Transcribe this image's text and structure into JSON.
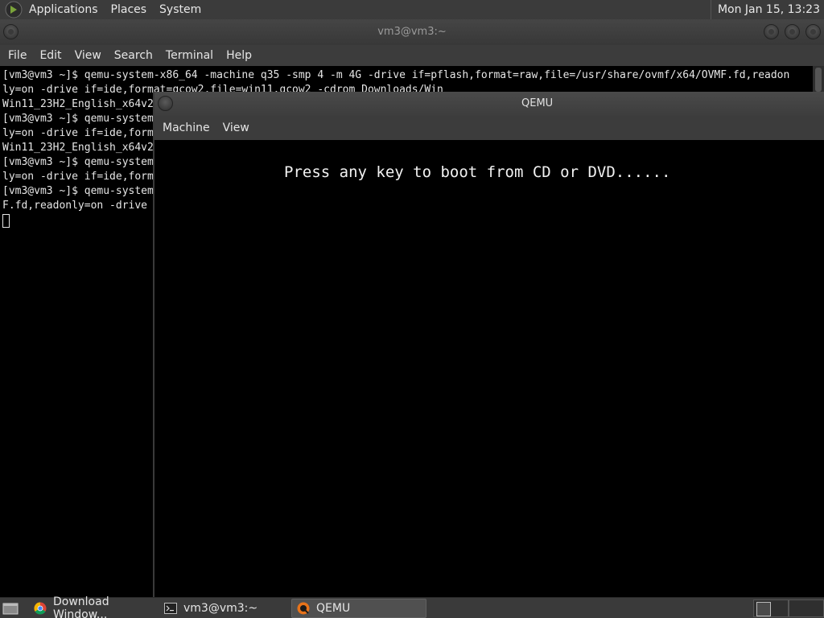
{
  "top_panel": {
    "menus": [
      "Applications",
      "Places",
      "System"
    ],
    "clock": "Mon Jan 15, 13:23"
  },
  "terminal": {
    "title": "vm3@vm3:~",
    "menus": [
      "File",
      "Edit",
      "View",
      "Search",
      "Terminal",
      "Help"
    ],
    "lines": [
      "[vm3@vm3 ~]$ qemu-system-x86_64 -machine q35 -smp 4 -m 4G -drive if=pflash,format=raw,file=/usr/share/ovmf/x64/OVMF.fd,readon",
      "ly=on -drive if=ide,format=qcow2,file=win11.qcow2 -cdrom Downloads/Win",
      "Win11_23H2_English_x64v2",
      "[vm3@vm3 ~]$ qemu-system",
      "ly=on -drive if=ide,form",
      "Win11_23H2_English_x64v2",
      "[vm3@vm3 ~]$ qemu-system",
      "ly=on -drive if=ide,form",
      "[vm3@vm3 ~]$ qemu-system",
      "F.fd,readonly=on -drive "
    ]
  },
  "qemu": {
    "title": "QEMU",
    "menus": [
      "Machine",
      "View"
    ],
    "screen_text": "Press any key to boot from CD or DVD......"
  },
  "taskbar": {
    "tasks": [
      {
        "label": "Download Window...",
        "icon": "chrome-icon"
      },
      {
        "label": "vm3@vm3:~",
        "icon": "terminal-icon"
      },
      {
        "label": "QEMU",
        "icon": "qemu-icon"
      }
    ]
  }
}
